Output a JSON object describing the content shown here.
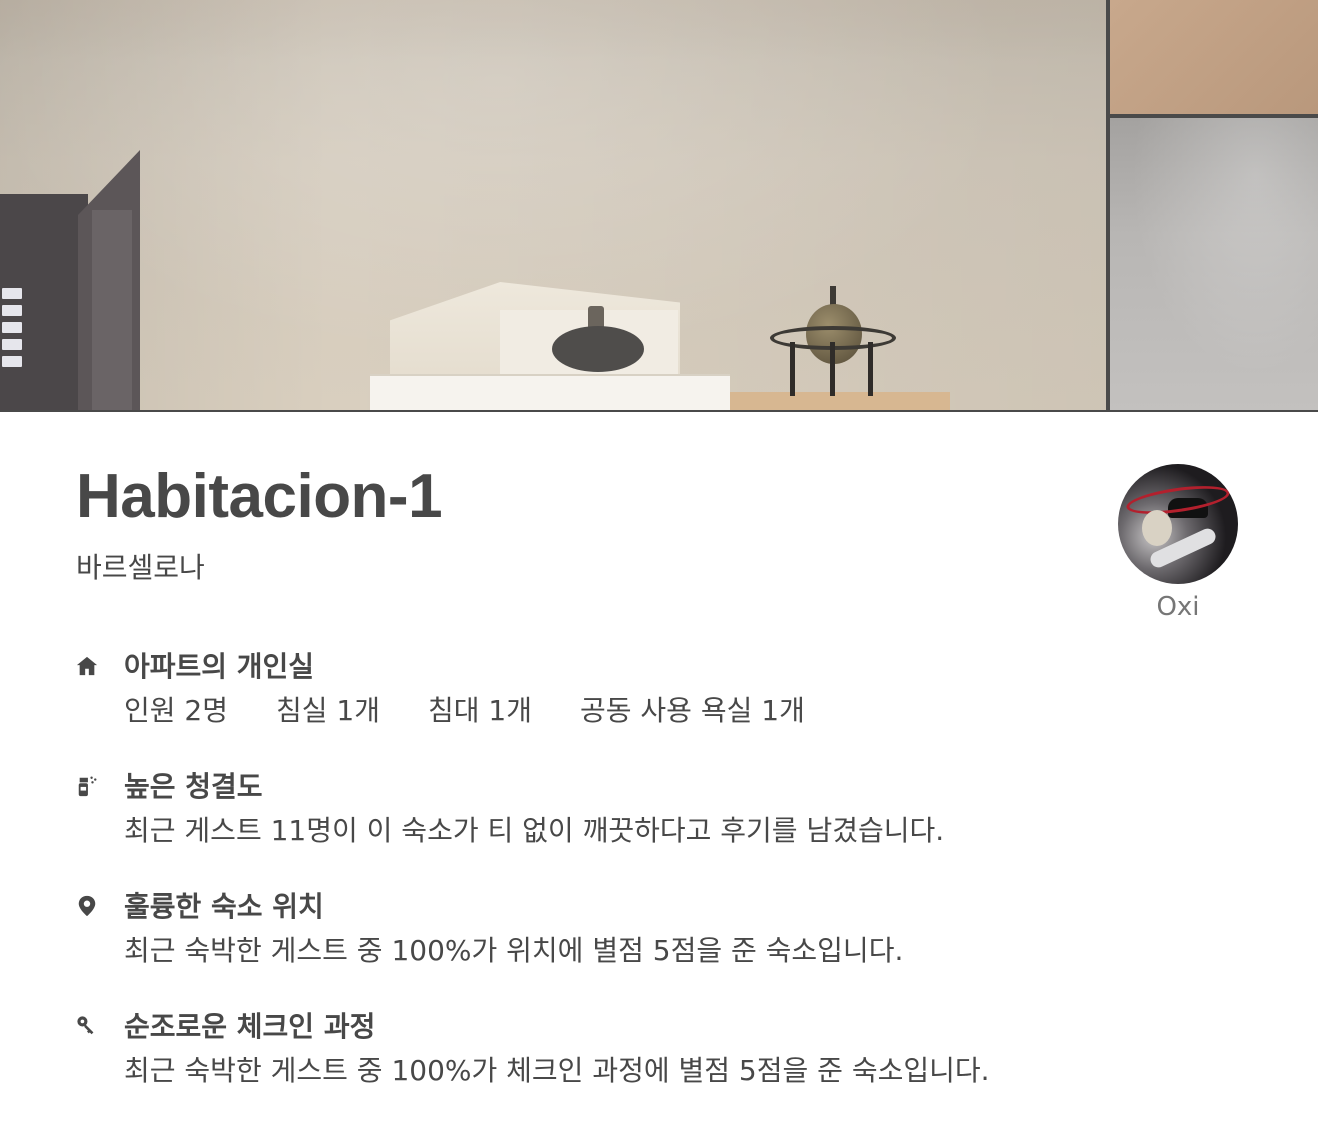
{
  "listing": {
    "title": "Habitacion-1",
    "location": "바르셀로나"
  },
  "host": {
    "name": "Oxi"
  },
  "room_type": {
    "icon": "home-icon",
    "title": "아파트의 개인실",
    "specs": [
      "인원 2명",
      "침실 1개",
      "침대 1개",
      "공동 사용 욕실 1개"
    ]
  },
  "highlights": [
    {
      "icon": "cleaning-spray-icon",
      "title": "높은 청결도",
      "description": "최근 게스트 11명이 이 숙소가 티 없이 깨끗하다고 후기를 남겼습니다."
    },
    {
      "icon": "location-pin-icon",
      "title": "훌륭한 숙소 위치",
      "description": "최근 숙박한 게스트 중 100%가 위치에 별점 5점을 준 숙소입니다."
    },
    {
      "icon": "key-icon",
      "title": "순조로운 체크인 과정",
      "description": "최근 숙박한 게스트 중 100%가 체크인 과정에 별점 5점을 준 숙소입니다."
    }
  ]
}
